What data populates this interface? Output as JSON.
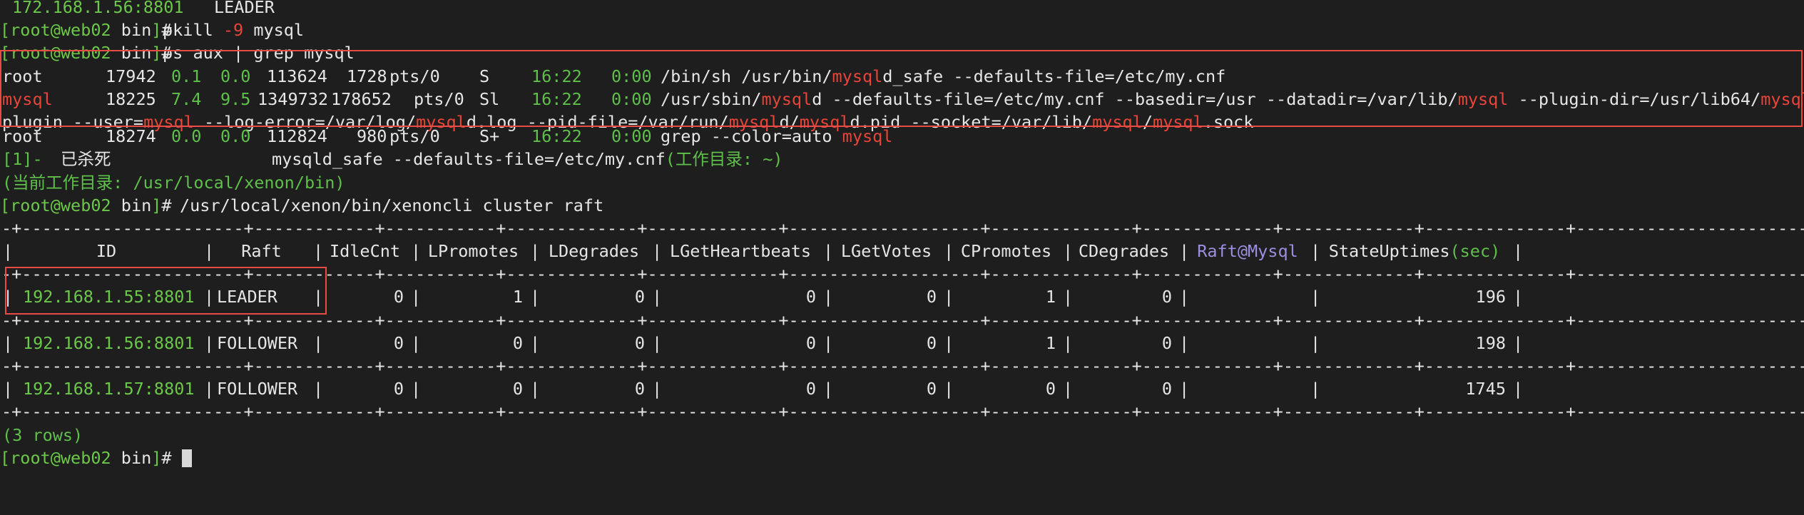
{
  "prompt": {
    "user_host": "root@web02",
    "dir": "bin",
    "sym": "#"
  },
  "top_line": {
    "ip": "172.168.1.56:8801",
    "role": "LEADER"
  },
  "commands": {
    "pkill": {
      "a": "pkill ",
      "b": "-9",
      "c": " mysql"
    },
    "ps": "ps aux | grep mysql",
    "raft": "/usr/local/xenon/bin/xenoncli cluster raft"
  },
  "ps_rows": [
    {
      "user": "root",
      "pid": "17942",
      "cpu": "0.1",
      "mem": "0.0",
      "vsz": "113624",
      "rss": "1728",
      "tty": "pts/0",
      "stat": "S",
      "start": "16:22",
      "time": "0:00",
      "cmd": [
        "/bin/sh /usr/bin/",
        "mysql",
        "d_safe --defaults-file=/etc/my.cnf"
      ]
    },
    {
      "user": "mysql",
      "pid": "18225",
      "cpu": "7.4",
      "mem": "9.5",
      "vsz": "1349732",
      "rss": "178652",
      "tty": "pts/0",
      "stat": "Sl",
      "start": "16:22",
      "time": "0:00",
      "cmd": [
        "/usr/sbin/",
        "mysql",
        "d --defaults-file=/etc/my.cnf --basedir=/usr --datadir=/var/lib/",
        "mysql",
        " --plugin-dir=/usr/lib64/",
        "mysql",
        "/"
      ]
    },
    {
      "cont": [
        "plugin --user=",
        "mysql",
        " --log-error=/var/log/",
        "mysql",
        "d.log --pid-file=/var/run/",
        "mysql",
        "d/",
        "mysql",
        "d.pid --socket=/var/lib/",
        "mysql",
        "/",
        "mysql",
        ".sock"
      ]
    },
    {
      "user": "root",
      "pid": "18274",
      "cpu": "0.0",
      "mem": "0.0",
      "vsz": "112824",
      "rss": "980",
      "tty": "pts/0",
      "stat": "S+",
      "start": "16:22",
      "time": "0:00",
      "cmd": [
        "grep --color=auto ",
        "mysql",
        ""
      ]
    }
  ],
  "killed_line": {
    "job": "[1]-",
    "status": "已杀死",
    "cmd": "mysqld_safe --defaults-file=/etc/my.cnf",
    "wd": "(工作目录: ~)"
  },
  "cwd_line": "(当前工作目录: /usr/local/xenon/bin)",
  "raft_table": {
    "headers": [
      "ID",
      "Raft",
      "IdleCnt",
      "LPromotes",
      "LDegrades",
      "LGetHeartbeats",
      "LGetVotes",
      "CPromotes",
      "CDegrades",
      "Raft@Mysql",
      "StateUptimes(sec)"
    ],
    "rows": [
      [
        "192.168.1.55:8801",
        "LEADER",
        "0",
        "1",
        "0",
        "0",
        "0",
        "1",
        "0",
        "",
        "196"
      ],
      [
        "192.168.1.56:8801",
        "FOLLOWER",
        "0",
        "0",
        "0",
        "0",
        "0",
        "1",
        "0",
        "",
        "198"
      ],
      [
        "192.168.1.57:8801",
        "FOLLOWER",
        "0",
        "0",
        "0",
        "0",
        "0",
        "0",
        "0",
        "",
        "1745"
      ]
    ]
  },
  "rows_count": "(3 rows)",
  "colors": {
    "prompt": "#6cc84a",
    "highlight": "#e8443a",
    "box": "#e84a44",
    "header_accent": "#9b8fe0"
  }
}
